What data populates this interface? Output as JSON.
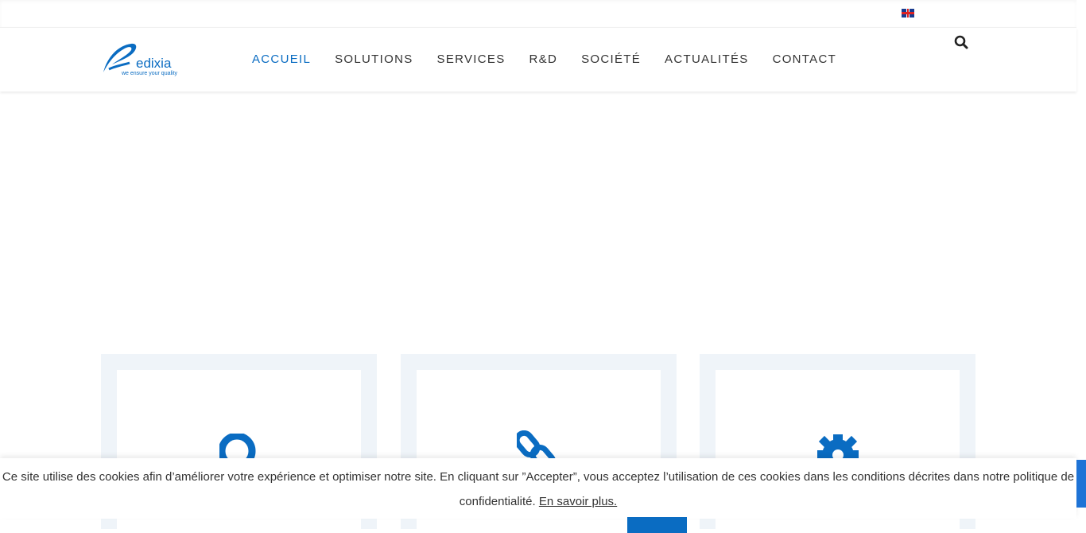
{
  "brand": {
    "name": "edixia",
    "tagline": "we ensure your quality",
    "accent": "#0a6cc2"
  },
  "language": {
    "icon": "uk-flag-icon"
  },
  "nav": {
    "items": [
      {
        "label": "ACCUEIL",
        "active": true
      },
      {
        "label": "SOLUTIONS"
      },
      {
        "label": "SERVICES"
      },
      {
        "label": "R&D"
      },
      {
        "label": "SOCIÉTÉ"
      },
      {
        "label": "ACTUALITÉS"
      },
      {
        "label": "CONTACT"
      }
    ]
  },
  "cards": [
    {
      "icon": "search-icon"
    },
    {
      "icon": "link-icon"
    },
    {
      "icon": "gear-icon"
    }
  ],
  "cookie": {
    "text": "Ce site utilise des cookies afin d’améliorer votre expérience et optimiser notre site. En cliquant sur ”Accepter”, vous acceptez l’utilisation de ces cookies dans les conditions décrites dans notre politique de confidentialité.",
    "link": "En savoir plus."
  }
}
